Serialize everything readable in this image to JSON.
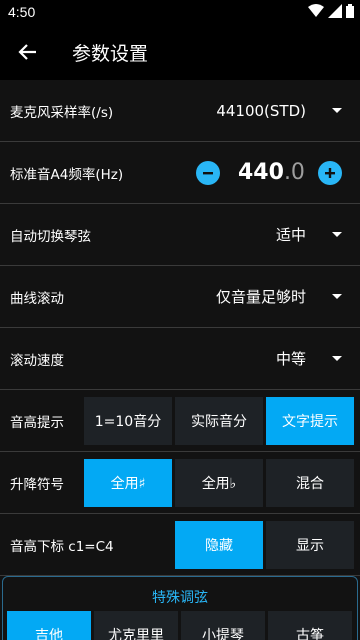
{
  "status": {
    "time": "4:50"
  },
  "header": {
    "title": "参数设置"
  },
  "rows": {
    "mic_rate": {
      "label": "麦克风采样率(/s)",
      "value": "44100(STD)"
    },
    "a4": {
      "label": "标准音A4频率(Hz)",
      "int": "440",
      "dec": ".0"
    },
    "auto_switch": {
      "label": "自动切换琴弦",
      "value": "适中"
    },
    "curve_scroll": {
      "label": "曲线滚动",
      "value": "仅音量足够时"
    },
    "scroll_speed": {
      "label": "滚动速度",
      "value": "中等"
    },
    "pitch_hint": {
      "label": "音高提示",
      "options": [
        "1=10音分",
        "实际音分",
        "文字提示"
      ],
      "selected": 2
    },
    "accidental": {
      "label": "升降符号",
      "options": [
        "全用♯",
        "全用♭",
        "混合"
      ],
      "selected": 0
    },
    "subscript": {
      "label": "音高下标 c1=C4",
      "options": [
        "隐藏",
        "显示"
      ],
      "selected": 0
    }
  },
  "special": {
    "title": "特殊调弦",
    "options": [
      "吉他",
      "尤克里里",
      "小提琴",
      "古筝"
    ],
    "selected": 0
  },
  "colors": {
    "accent": "#03a9f4",
    "bg": "#121212",
    "segment_bg": "#1e2226"
  }
}
